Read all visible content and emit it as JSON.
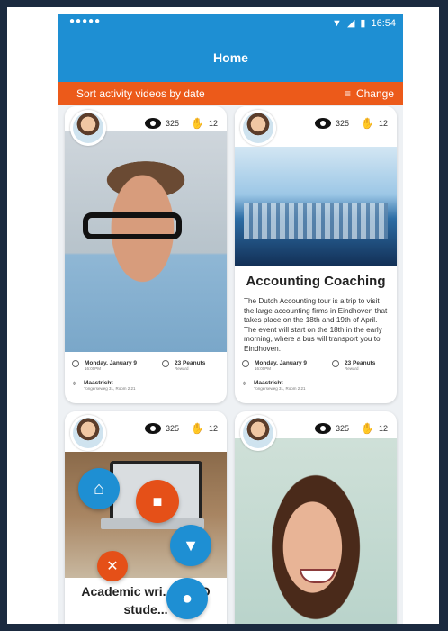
{
  "status": {
    "dots": "●●●●●",
    "time": "16:54"
  },
  "appbar": {
    "title": "Home"
  },
  "sort": {
    "label": "Sort activity videos by date",
    "change": "Change"
  },
  "cards": [
    {
      "views": "325",
      "likes": "12"
    },
    {
      "views": "325",
      "likes": "12",
      "title": "Accounting Coaching",
      "description": "The Dutch Accounting tour is a trip to visit the large accounting firms in Eindhoven that takes place on the 18th and 19th of April. The event will start on the 18th in the early morning, where a bus will transport you to Eindhoven."
    },
    {
      "views": "325",
      "likes": "12",
      "title": "Academic wri... r PhD stude..."
    },
    {
      "views": "325",
      "likes": "12"
    }
  ],
  "meta": {
    "date": "Monday, January 9",
    "time_sub": "16:00PM",
    "reward": "23 Peanuts",
    "reward_sub": "Reward",
    "location": "Maastricht",
    "address": "Tongerseweg 31, Room 2.21"
  },
  "fab": {
    "home": "home-icon",
    "video": "video-icon",
    "filter": "filter-icon",
    "close": "close-icon",
    "profile": "profile-icon"
  },
  "colors": {
    "primary": "#1e8fd3",
    "accent": "#ec5a1a"
  }
}
